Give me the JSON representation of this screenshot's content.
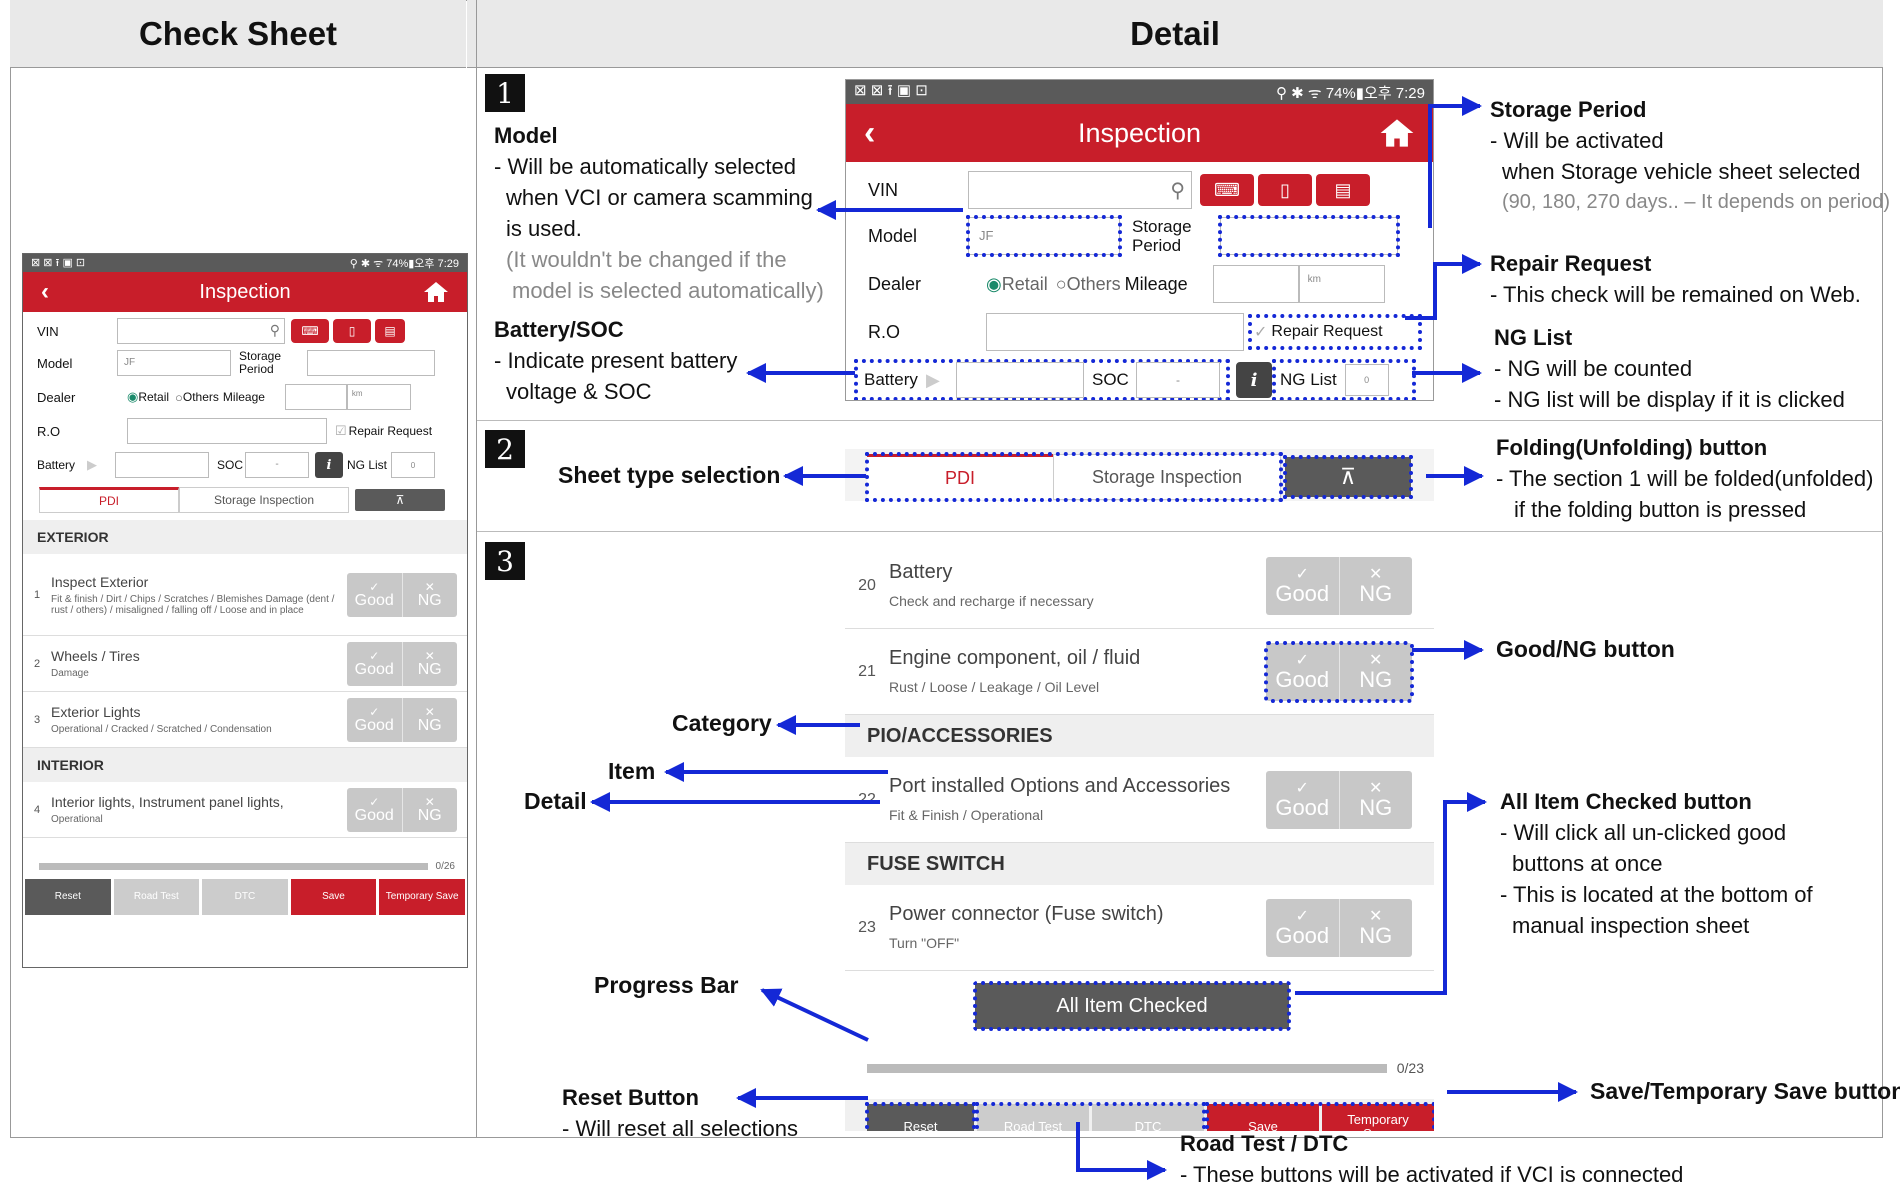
{
  "headers": {
    "left": "Check Sheet",
    "right": "Detail"
  },
  "section_numbers": [
    "1",
    "2",
    "3"
  ],
  "phone": {
    "status_left": "⊠ ⊠ ⭱ ▣ ⊡",
    "status_right": "⚲ ✱ ᯤ 74%▮오후 7:29",
    "title": "Inspection",
    "labels": {
      "vin": "VIN",
      "model": "Model",
      "storage_period": "Storage Period",
      "dealer": "Dealer",
      "retail": "Retail",
      "others": "Others",
      "mileage": "Mileage",
      "ro": "R.O",
      "repair_request": "Repair Request",
      "battery": "Battery",
      "soc": "SOC",
      "ng_list": "NG List"
    },
    "values": {
      "model": "JF",
      "km": "km",
      "soc": "-",
      "ng_count": "0"
    },
    "tabs": {
      "pdi": "PDI",
      "storage": "Storage Inspection"
    },
    "good": "Good",
    "ng": "NG",
    "left_sheet": [
      {
        "type": "cat",
        "label": "EXTERIOR"
      },
      {
        "type": "item",
        "no": "1",
        "title": "Inspect Exterior",
        "detail": "Fit & finish / Dirt / Chips / Scratches / Blemishes Damage (dent / rust / others) / misaligned / falling off / Loose and in place"
      },
      {
        "type": "item",
        "no": "2",
        "title": "Wheels / Tires",
        "detail": "Damage"
      },
      {
        "type": "item",
        "no": "3",
        "title": "Exterior Lights",
        "detail": "Operational / Cracked / Scratched / Condensation"
      },
      {
        "type": "cat",
        "label": "INTERIOR"
      },
      {
        "type": "item",
        "no": "4",
        "title": "Interior lights, Instrument panel lights,",
        "detail": "Operational"
      }
    ],
    "left_progress": "0/26",
    "right_sheet": [
      {
        "type": "item",
        "no": "20",
        "title": "Battery",
        "detail": "Check and recharge if necessary"
      },
      {
        "type": "item",
        "no": "21",
        "title": "Engine component, oil / fluid",
        "detail": "Rust / Loose / Leakage / Oil Level"
      },
      {
        "type": "cat",
        "label": "PIO/ACCESSORIES"
      },
      {
        "type": "item",
        "no": "22",
        "title": "Port installed Options and Accessories",
        "detail": "Fit & Finish / Operational"
      },
      {
        "type": "cat",
        "label": "FUSE SWITCH"
      },
      {
        "type": "item",
        "no": "23",
        "title": "Power connector (Fuse switch)",
        "detail": "Turn \"OFF\""
      }
    ],
    "all_item_checked": "All Item Checked",
    "right_progress": "0/23",
    "bottom_buttons": [
      "Reset",
      "Road Test",
      "DTC",
      "Save",
      "Temporary Save"
    ]
  },
  "annotations": {
    "model": {
      "title": "Model",
      "lines": [
        "- Will be automatically selected",
        "  when VCI or camera scamming",
        "  is used."
      ],
      "grey": [
        "(It wouldn't be changed if the",
        "  model is selected automatically)"
      ]
    },
    "battery": {
      "title": "Battery/SOC",
      "lines": [
        "- Indicate present battery",
        "  voltage & SOC"
      ]
    },
    "storage": {
      "title": "Storage Period",
      "lines": [
        "- Will be activated",
        "  when Storage vehicle sheet selected"
      ],
      "grey": "(90, 180, 270 days.. – It depends on period)"
    },
    "repair": {
      "title": "Repair Request",
      "lines": [
        "- This check will be remained on Web."
      ]
    },
    "nglist": {
      "title": "NG List",
      "lines": [
        "- NG will be counted",
        "- NG list will be display if it is clicked"
      ]
    },
    "sheet_type": "Sheet type selection",
    "folding": {
      "title": "Folding(Unfolding) button",
      "lines": [
        "- The section 1 will be folded(unfolded)",
        "  if the folding button is pressed"
      ]
    },
    "good_ng": "Good/NG button",
    "category": "Category",
    "item": "Item",
    "detail": "Detail",
    "all_checked": {
      "title": "All Item Checked button",
      "lines": [
        "- Will click all un-clicked good",
        "  buttons at once",
        "- This is located at the bottom of",
        "  manual inspection sheet"
      ]
    },
    "progress": "Progress Bar",
    "reset": {
      "title": "Reset Button",
      "lines": [
        "- Will reset all selections"
      ]
    },
    "save": "Save/Temporary Save button",
    "road": {
      "title": "Road Test / DTC",
      "lines": [
        "- These buttons will be activated if VCI is connected"
      ]
    }
  },
  "colors": {
    "brand_red": "#c81e2a",
    "annotation_blue": "#1428d6",
    "disabled_grey": "#c8c8c8",
    "dark_grey": "#5a5a5a"
  }
}
